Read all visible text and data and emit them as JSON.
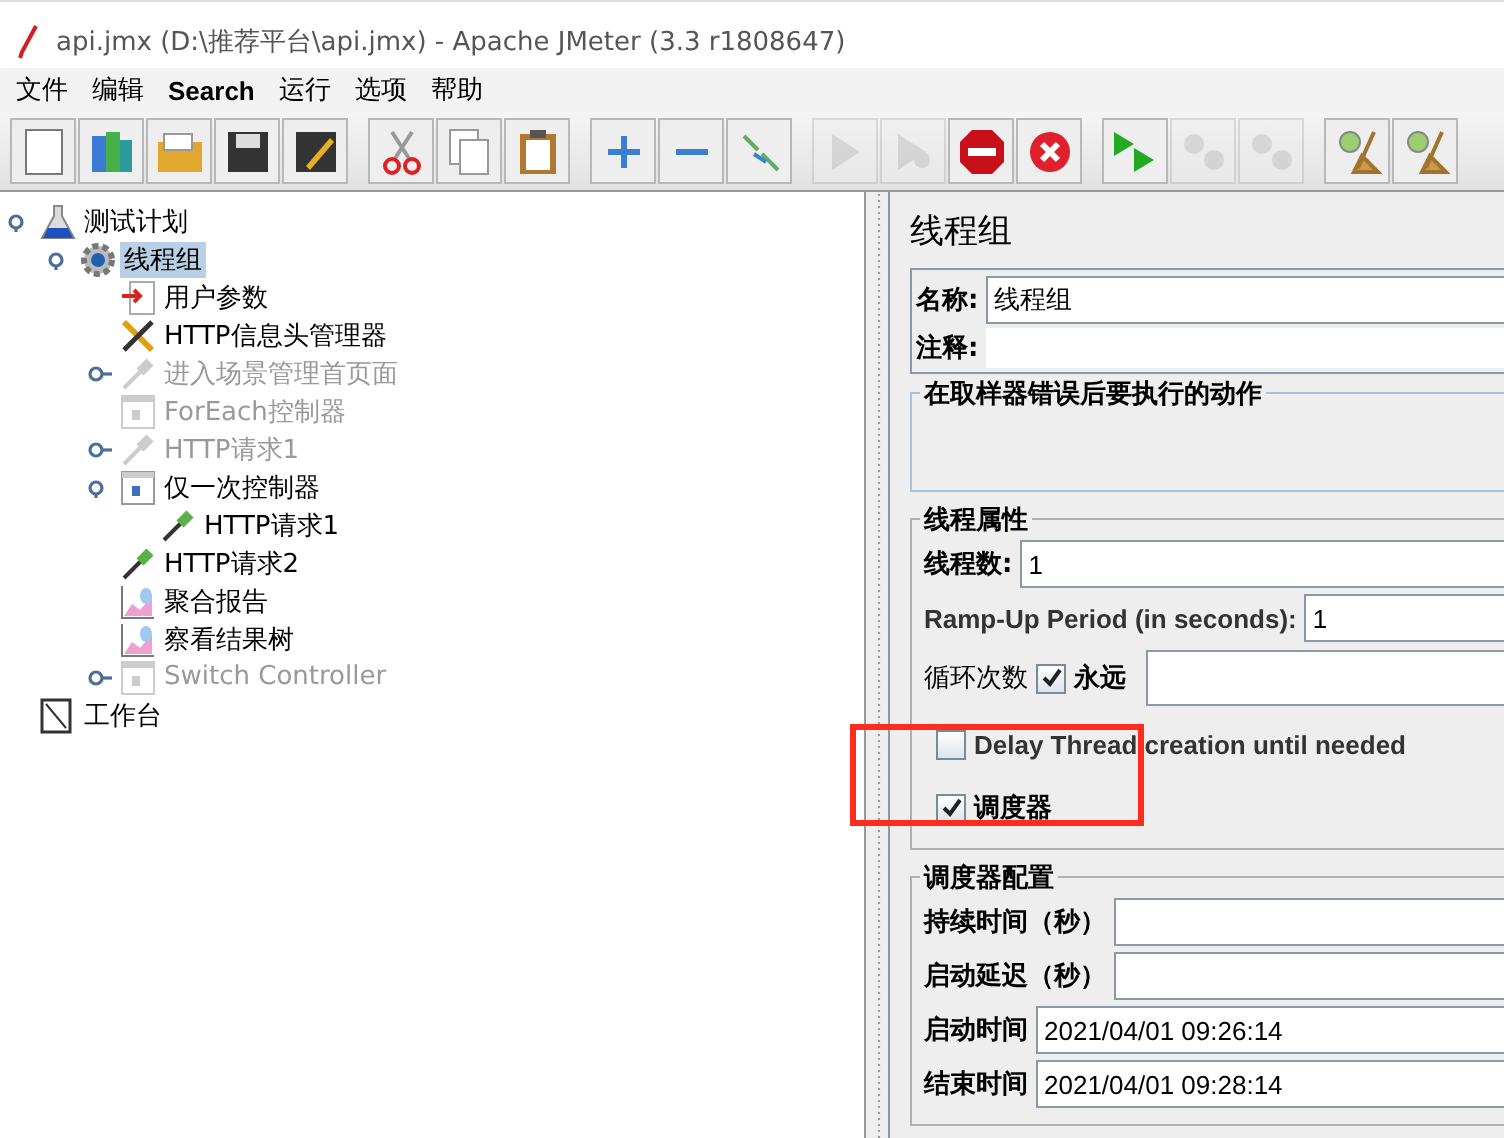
{
  "window": {
    "title": "api.jmx (D:\\推荐平台\\api.jmx) - Apache JMeter (3.3 r1808647)"
  },
  "menu": [
    "文件",
    "编辑",
    "Search",
    "运行",
    "选项",
    "帮助"
  ],
  "toolbar": [
    [
      {
        "kind": "new",
        "disabled": false
      },
      {
        "kind": "templates",
        "disabled": false
      },
      {
        "kind": "open",
        "disabled": false
      },
      {
        "kind": "save",
        "disabled": false
      },
      {
        "kind": "save-as",
        "disabled": false
      }
    ],
    [
      {
        "kind": "cut",
        "disabled": false
      },
      {
        "kind": "copy",
        "disabled": false
      },
      {
        "kind": "paste",
        "disabled": false
      }
    ],
    [
      {
        "kind": "expand",
        "disabled": false
      },
      {
        "kind": "collapse",
        "disabled": false
      },
      {
        "kind": "toggle",
        "disabled": false
      }
    ],
    [
      {
        "kind": "start",
        "disabled": true
      },
      {
        "kind": "start-no-pause",
        "disabled": true
      },
      {
        "kind": "stop",
        "disabled": false
      },
      {
        "kind": "shutdown",
        "disabled": false
      }
    ],
    [
      {
        "kind": "remote-start",
        "disabled": false
      },
      {
        "kind": "remote-stop",
        "disabled": true
      },
      {
        "kind": "remote-shutdown",
        "disabled": true
      }
    ],
    [
      {
        "kind": "clear",
        "disabled": false
      },
      {
        "kind": "clear-all",
        "disabled": false
      }
    ]
  ],
  "tree": [
    {
      "label": "测试计划",
      "kind": "plan",
      "disabled": false,
      "selected": false,
      "expanded": true,
      "children": [
        {
          "label": "线程组",
          "kind": "gear",
          "disabled": false,
          "selected": true,
          "expanded": true,
          "children": [
            {
              "label": "用户参数",
              "kind": "params",
              "disabled": false,
              "selected": false
            },
            {
              "label": "HTTP信息头管理器",
              "kind": "tools",
              "disabled": false,
              "selected": false
            },
            {
              "label": "进入场景管理首页面",
              "kind": "pipette",
              "disabled": true,
              "selected": false,
              "expanded": false
            },
            {
              "label": "ForEach控制器",
              "kind": "controller",
              "disabled": true,
              "selected": false
            },
            {
              "label": "HTTP请求1",
              "kind": "pipette",
              "disabled": true,
              "selected": false,
              "expanded": false
            },
            {
              "label": "仅一次控制器",
              "kind": "controller",
              "disabled": false,
              "selected": false,
              "expanded": true,
              "children": [
                {
                  "label": "HTTP请求1",
                  "kind": "pipette",
                  "disabled": false,
                  "selected": false
                }
              ]
            },
            {
              "label": "HTTP请求2",
              "kind": "pipette",
              "disabled": false,
              "selected": false
            },
            {
              "label": "聚合报告",
              "kind": "graph",
              "disabled": false,
              "selected": false
            },
            {
              "label": "察看结果树",
              "kind": "graph",
              "disabled": false,
              "selected": false
            },
            {
              "label": "Switch Controller",
              "kind": "controller",
              "disabled": true,
              "selected": false,
              "expanded": false
            }
          ]
        }
      ]
    },
    {
      "label": "工作台",
      "kind": "workbench",
      "disabled": false,
      "selected": false
    }
  ],
  "panel": {
    "title": "线程组",
    "name": {
      "label": "名称:",
      "value": "线程组"
    },
    "comment": {
      "label": "注释:"
    },
    "error_action": {
      "title": "在取样器错误后要执行的动作"
    },
    "thread_props": {
      "title": "线程属性",
      "threads": {
        "label": "线程数:",
        "value": "1"
      },
      "ramp_up": {
        "label": "Ramp-Up Period (in seconds):",
        "value": "1"
      },
      "loop": {
        "label": "循环次数",
        "forever_label": "永远",
        "forever_checked": true
      },
      "delay": {
        "label": "Delay Thread creation until needed",
        "checked": false
      },
      "scheduler": {
        "label": "调度器",
        "checked": true
      }
    },
    "scheduler_config": {
      "title": "调度器配置",
      "rows": [
        {
          "label": "持续时间（秒）",
          "value": ""
        },
        {
          "label": "启动延迟（秒）",
          "value": ""
        },
        {
          "label": "启动时间",
          "value": "2021/04/01 09:26:14"
        },
        {
          "label": "结束时间",
          "value": "2021/04/01 09:28:14"
        }
      ]
    }
  },
  "annotation": {
    "kind": "box"
  }
}
